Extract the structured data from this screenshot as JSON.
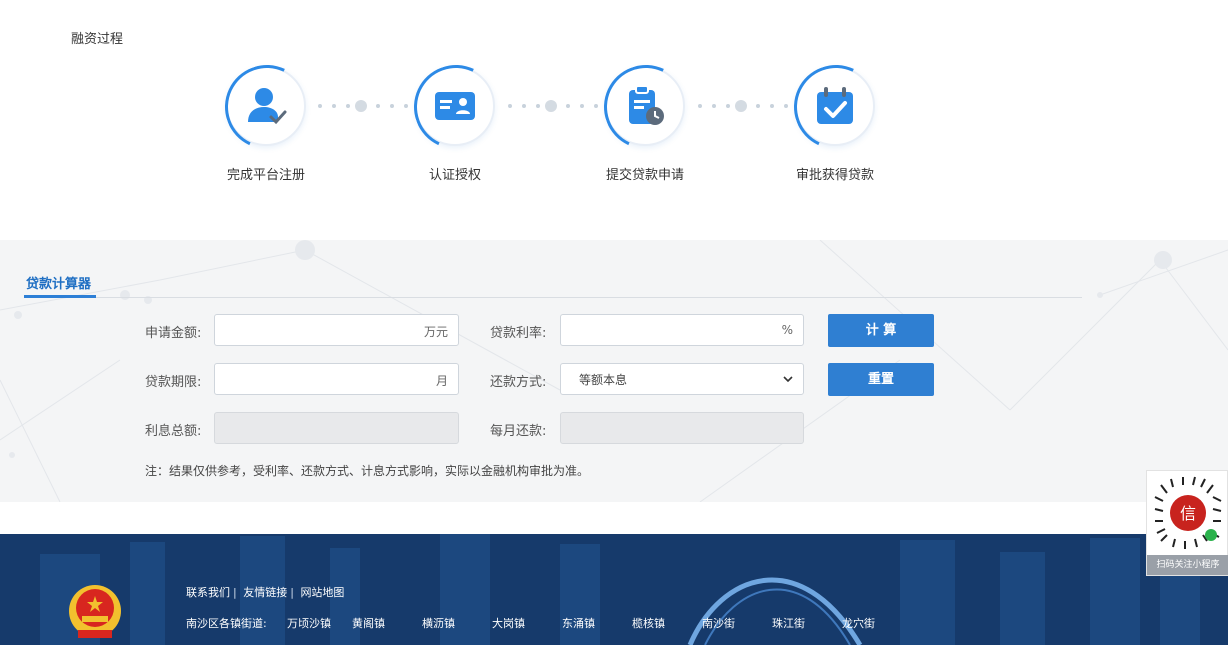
{
  "process": {
    "title": "融资过程",
    "steps": [
      {
        "label": "完成平台注册",
        "icon": "user-check-icon"
      },
      {
        "label": "认证授权",
        "icon": "id-card-icon"
      },
      {
        "label": "提交贷款申请",
        "icon": "clipboard-clock-icon"
      },
      {
        "label": "审批获得贷款",
        "icon": "calendar-check-icon"
      }
    ]
  },
  "calculator": {
    "tab_label": "贷款计算器",
    "amount_label": "申请金额:",
    "amount_unit": "万元",
    "rate_label": "贷款利率:",
    "rate_unit": "%",
    "term_label": "贷款期限:",
    "term_unit": "月",
    "method_label": "还款方式:",
    "method_value": "等额本息",
    "interest_label": "利息总额:",
    "monthly_label": "每月还款:",
    "calc_button": "计 算",
    "reset_button": "重置",
    "note": "注：结果仅供参考，受利率、还款方式、计息方式影响，实际以金融机构审批为准。"
  },
  "footer": {
    "link_contact": "联系我们",
    "link_friends": "友情链接",
    "link_sitemap": "网站地图",
    "towns_label": "南沙区各镇街道:",
    "towns": [
      "万顷沙镇",
      "黄阁镇",
      "横沥镇",
      "大岗镇",
      "东涌镇",
      "榄核镇",
      "南沙街",
      "珠江街",
      "龙穴街"
    ]
  },
  "qr": {
    "caption": "扫码关注小程序"
  },
  "colors": {
    "accent": "#2f7fd2",
    "footer_bg": "#163a6b",
    "band_bg": "#f4f5f6"
  }
}
